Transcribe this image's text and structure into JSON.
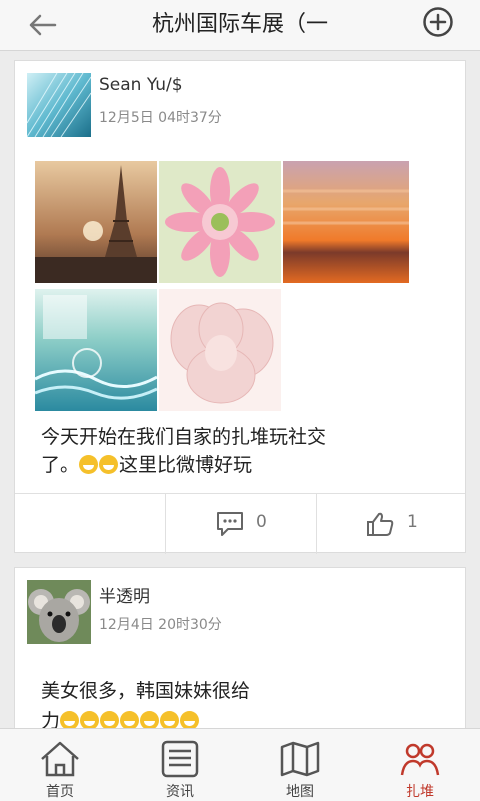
{
  "header": {
    "title": "杭州国际车展（一",
    "back_icon": "arrow-left-icon",
    "add_icon": "plus-circle-icon"
  },
  "posts": [
    {
      "username": "Sean Yu/$",
      "time": "12月5日 04时37分",
      "text_line1": "今天开始在我们自家的扎堆玩社交",
      "text_line2_prefix": "了。",
      "text_line2_suffix": "这里比微博好玩",
      "comment_count": "0",
      "like_count": "1"
    },
    {
      "username": "半透明",
      "time": "12月4日 20时30分",
      "text_line1": "美女很多，韩国妹妹很给",
      "text_line2_prefix": "力"
    }
  ],
  "nav": {
    "items": [
      {
        "label": "首页",
        "icon": "home-icon"
      },
      {
        "label": "资讯",
        "icon": "news-list-icon"
      },
      {
        "label": "地图",
        "icon": "map-icon"
      },
      {
        "label": "扎堆",
        "icon": "people-icon"
      }
    ]
  },
  "colors": {
    "accent": "#c0392b",
    "background": "#ececec",
    "header_bg": "#f7f7f7"
  }
}
